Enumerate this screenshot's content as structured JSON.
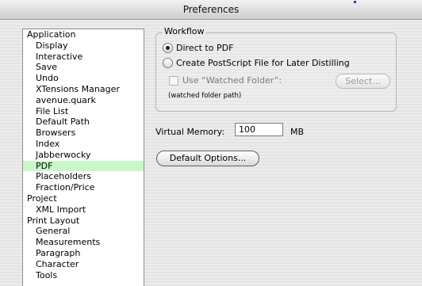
{
  "window": {
    "title": "Preferences"
  },
  "tree": {
    "items": [
      {
        "label": "Application",
        "level": 0,
        "selected": false
      },
      {
        "label": "Display",
        "level": 1,
        "selected": false
      },
      {
        "label": "Interactive",
        "level": 1,
        "selected": false
      },
      {
        "label": "Save",
        "level": 1,
        "selected": false
      },
      {
        "label": "Undo",
        "level": 1,
        "selected": false
      },
      {
        "label": "XTensions Manager",
        "level": 1,
        "selected": false
      },
      {
        "label": "avenue.quark",
        "level": 1,
        "selected": false
      },
      {
        "label": "File List",
        "level": 1,
        "selected": false
      },
      {
        "label": "Default Path",
        "level": 1,
        "selected": false
      },
      {
        "label": "Browsers",
        "level": 1,
        "selected": false
      },
      {
        "label": "Index",
        "level": 1,
        "selected": false
      },
      {
        "label": "Jabberwocky",
        "level": 1,
        "selected": false
      },
      {
        "label": "PDF",
        "level": 1,
        "selected": true
      },
      {
        "label": "Placeholders",
        "level": 1,
        "selected": false
      },
      {
        "label": "Fraction/Price",
        "level": 1,
        "selected": false
      },
      {
        "label": "Project",
        "level": 0,
        "selected": false
      },
      {
        "label": "XML Import",
        "level": 1,
        "selected": false
      },
      {
        "label": "Print Layout",
        "level": 0,
        "selected": false
      },
      {
        "label": "General",
        "level": 1,
        "selected": false
      },
      {
        "label": "Measurements",
        "level": 1,
        "selected": false
      },
      {
        "label": "Paragraph",
        "level": 1,
        "selected": false
      },
      {
        "label": "Character",
        "level": 1,
        "selected": false
      },
      {
        "label": "Tools",
        "level": 1,
        "selected": false
      }
    ],
    "selected_color": "#c9f7c8"
  },
  "workflow": {
    "label": "Workflow",
    "direct_label": "Direct to PDF",
    "direct_selected": true,
    "postscript_label": "Create PostScript File for Later Distilling",
    "postscript_selected": false,
    "watched_label": "Use “Watched Folder”:",
    "watched_checked": false,
    "select_label": "Select...",
    "path_note": "(watched folder path)"
  },
  "memory": {
    "label": "Virtual Memory:",
    "value": "100",
    "unit": "MB"
  },
  "default_options_label": "Default Options..."
}
